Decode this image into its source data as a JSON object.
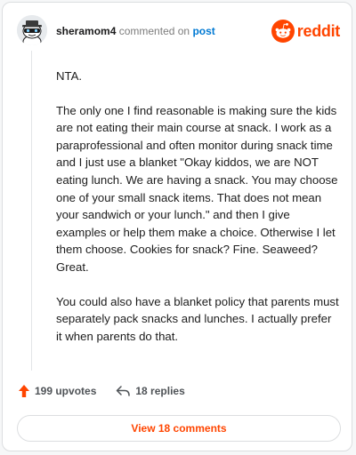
{
  "header": {
    "username": "sheramom4",
    "action_text": "commented on",
    "post_link": "post"
  },
  "brand": {
    "name": "reddit",
    "color": "#ff4500"
  },
  "comment": {
    "paragraphs": [
      "NTA.",
      "The only one I find reasonable is making sure the kids are not eating their main course at snack. I work as a paraprofessional and often monitor during snack time and I just use a blanket \"Okay kiddos, we are NOT eating lunch. We are having a snack. You may choose one of your small snack items. That does not mean your sandwich or your lunch.\" and then I give examples or help them make a choice. Otherwise I let them choose. Cookies for snack? Fine. Seaweed? Great.",
      "You could also have a blanket policy that parents must separately pack snacks and lunches. I actually prefer it when parents do that."
    ]
  },
  "footer": {
    "upvotes": "199 upvotes",
    "replies": "18 replies",
    "upvote_icon": "upvote-arrow-icon",
    "reply_icon": "reply-arrow-icon"
  },
  "view_button": {
    "label": "View 18 comments"
  }
}
